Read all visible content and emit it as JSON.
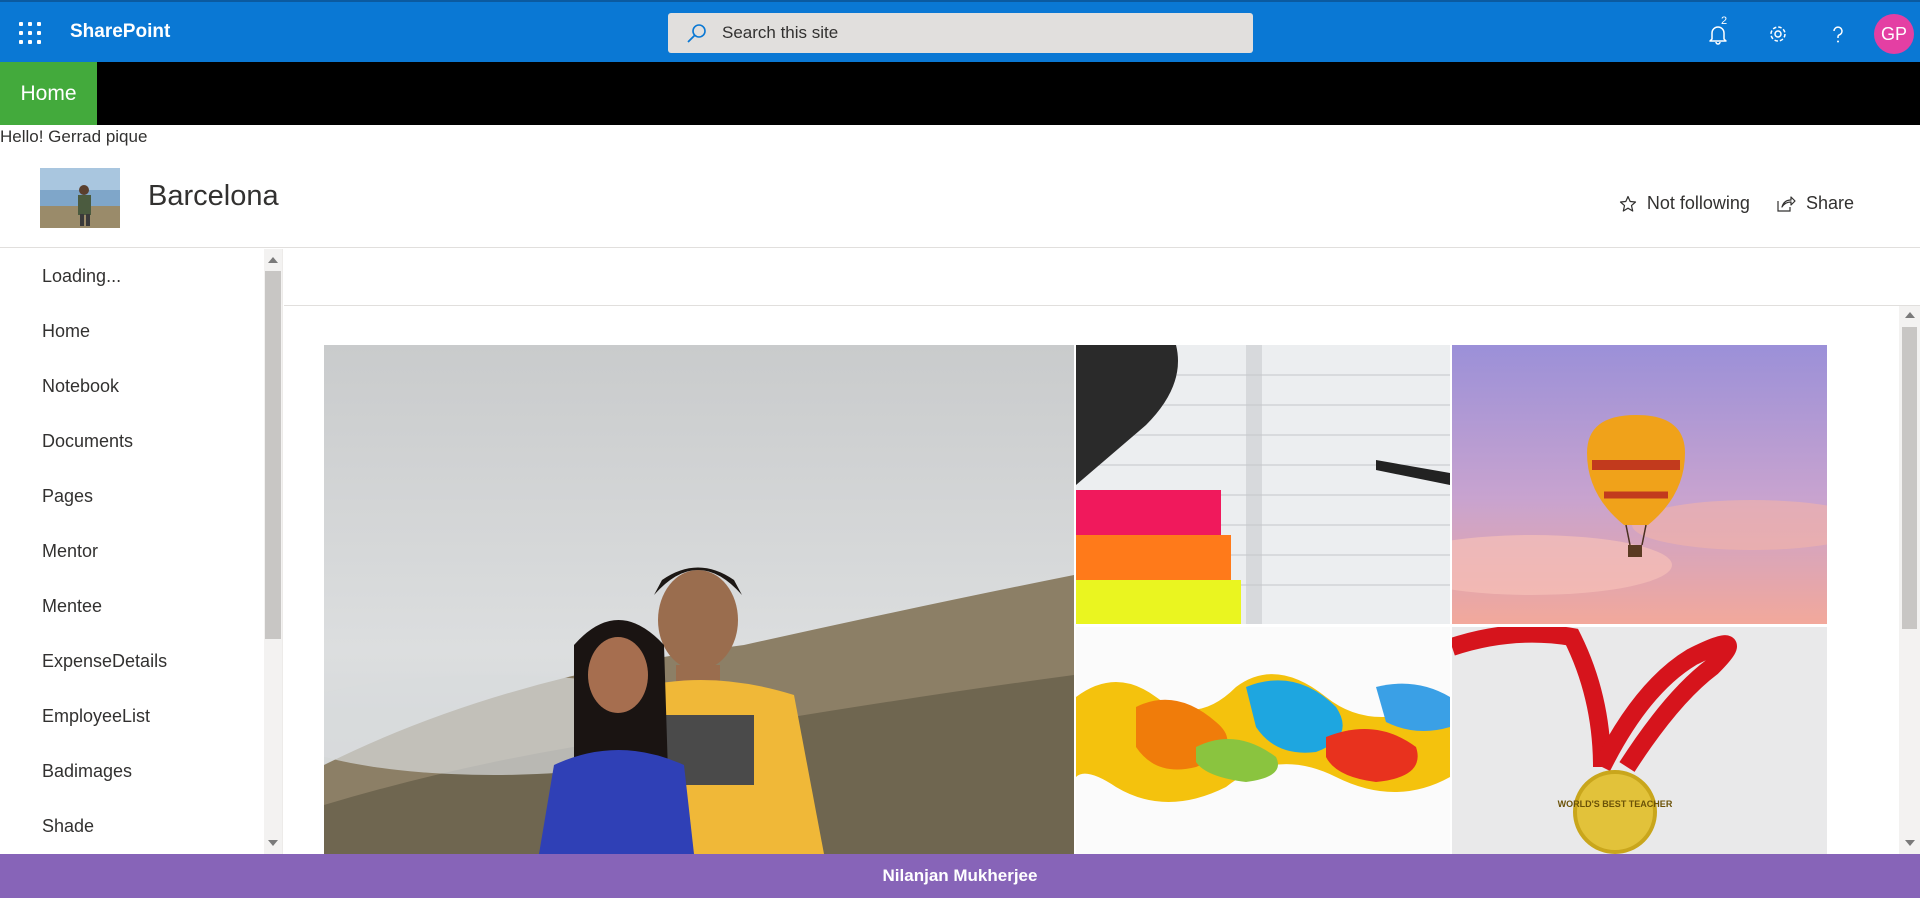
{
  "suite": {
    "brand": "SharePoint",
    "search_placeholder": "Search this site",
    "notification_count": "2",
    "avatar_initials": "GP",
    "icons": [
      "app-launcher-icon",
      "search-icon",
      "bell-icon",
      "gear-icon",
      "help-icon"
    ]
  },
  "hub": {
    "home_label": "Home",
    "color": "#43aa3c"
  },
  "greeting": "Hello! Gerrad pique",
  "site": {
    "title": "Barcelona",
    "follow_label": "Not following",
    "share_label": "Share"
  },
  "nav": {
    "items": [
      {
        "label": "Loading..."
      },
      {
        "label": "Home"
      },
      {
        "label": "Notebook"
      },
      {
        "label": "Documents"
      },
      {
        "label": "Pages"
      },
      {
        "label": "Mentor"
      },
      {
        "label": "Mentee"
      },
      {
        "label": "ExpenseDetails"
      },
      {
        "label": "EmployeeList"
      },
      {
        "label": "Badimages"
      },
      {
        "label": "Shade"
      }
    ]
  },
  "hero": {
    "tiles": [
      "couple-photo",
      "notebook-photo",
      "balloon-photo",
      "ink-photo",
      "medal-photo"
    ],
    "medal_text": "WORLD'S BEST TEACHER"
  },
  "footer": {
    "text": "Nilanjan Mukherjee",
    "color": "#8764b8"
  }
}
